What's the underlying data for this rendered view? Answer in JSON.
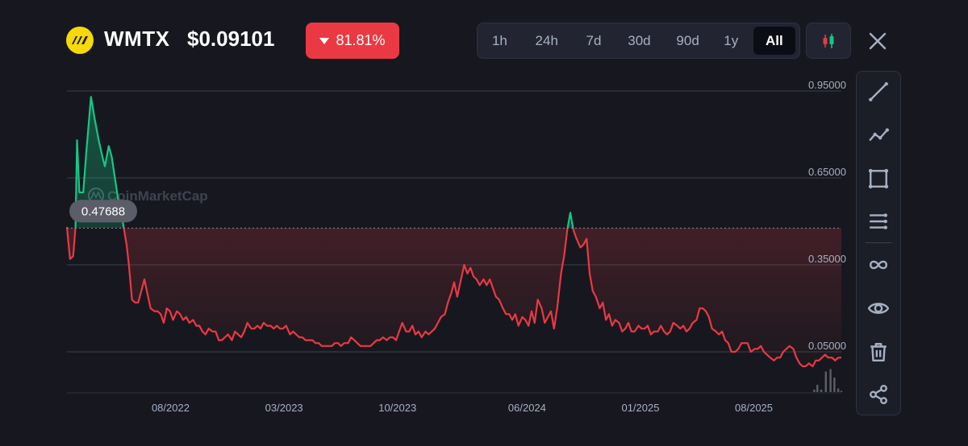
{
  "header": {
    "symbol": "WMTX",
    "price": "$0.09101",
    "change": "81.81%",
    "change_direction": "down",
    "logo_icon": "wmtx-logo-icon",
    "ranges": [
      {
        "label": "1h",
        "active": false
      },
      {
        "label": "24h",
        "active": false
      },
      {
        "label": "7d",
        "active": false
      },
      {
        "label": "30d",
        "active": false
      },
      {
        "label": "90d",
        "active": false
      },
      {
        "label": "1y",
        "active": false
      },
      {
        "label": "All",
        "active": true
      }
    ],
    "candle_icon": "candlestick-icon",
    "close_icon": "close-icon"
  },
  "toolbar": {
    "tools": [
      "trend-line-icon",
      "multi-point-line-icon",
      "rectangle-icon",
      "horizontal-lines-icon",
      "infinity-icon",
      "eye-icon",
      "trash-icon",
      "share-icon"
    ]
  },
  "colors": {
    "up": "#16c784",
    "down": "#ea3943",
    "background": "#17181f",
    "grid": "#3a3f4d"
  },
  "chart_data": {
    "type": "line",
    "watermark": "CoinMarketCap",
    "reference_label": "0.47688",
    "reference_value": 0.47688,
    "y_ticks": [
      {
        "label": "0.95000",
        "value": 0.95
      },
      {
        "label": "0.65000",
        "value": 0.65
      },
      {
        "label": "0.35000",
        "value": 0.35
      },
      {
        "label": "0.05000",
        "value": 0.05
      }
    ],
    "ylim": [
      -0.09,
      0.99
    ],
    "x_ticks": [
      {
        "label": "08/2022",
        "t": 0.1338
      },
      {
        "label": "03/2023",
        "t": 0.2804
      },
      {
        "label": "10/2023",
        "t": 0.4268
      },
      {
        "label": "06/2024",
        "t": 0.5942
      },
      {
        "label": "01/2025",
        "t": 0.7406
      },
      {
        "label": "08/2025",
        "t": 0.887
      }
    ],
    "xlim": [
      0,
      1
    ],
    "series": [
      {
        "points": [
          [
            0.0,
            0.48
          ],
          [
            0.004,
            0.37
          ],
          [
            0.008,
            0.38
          ],
          [
            0.011,
            0.48
          ],
          [
            0.013,
            0.78
          ],
          [
            0.016,
            0.6
          ],
          [
            0.021,
            0.6
          ],
          [
            0.025,
            0.74
          ],
          [
            0.031,
            0.93
          ],
          [
            0.036,
            0.85
          ],
          [
            0.041,
            0.78
          ],
          [
            0.046,
            0.72
          ],
          [
            0.049,
            0.69
          ],
          [
            0.054,
            0.76
          ],
          [
            0.058,
            0.72
          ],
          [
            0.063,
            0.63
          ],
          [
            0.067,
            0.56
          ],
          [
            0.072,
            0.5
          ],
          [
            0.077,
            0.42
          ],
          [
            0.08,
            0.35
          ],
          [
            0.084,
            0.23
          ],
          [
            0.088,
            0.22
          ],
          [
            0.092,
            0.22
          ],
          [
            0.096,
            0.26
          ],
          [
            0.1,
            0.3
          ],
          [
            0.104,
            0.25
          ],
          [
            0.108,
            0.2
          ],
          [
            0.113,
            0.19
          ],
          [
            0.117,
            0.19
          ],
          [
            0.121,
            0.18
          ],
          [
            0.125,
            0.15
          ],
          [
            0.129,
            0.2
          ],
          [
            0.133,
            0.19
          ],
          [
            0.137,
            0.16
          ],
          [
            0.142,
            0.19
          ],
          [
            0.146,
            0.18
          ],
          [
            0.15,
            0.16
          ],
          [
            0.154,
            0.17
          ],
          [
            0.158,
            0.15
          ],
          [
            0.163,
            0.16
          ],
          [
            0.167,
            0.14
          ],
          [
            0.171,
            0.14
          ],
          [
            0.175,
            0.12
          ],
          [
            0.179,
            0.11
          ],
          [
            0.183,
            0.13
          ],
          [
            0.188,
            0.12
          ],
          [
            0.192,
            0.12
          ],
          [
            0.196,
            0.09
          ],
          [
            0.2,
            0.09
          ],
          [
            0.204,
            0.1
          ],
          [
            0.208,
            0.11
          ],
          [
            0.213,
            0.09
          ],
          [
            0.217,
            0.12
          ],
          [
            0.221,
            0.11
          ],
          [
            0.225,
            0.1
          ],
          [
            0.229,
            0.12
          ],
          [
            0.233,
            0.15
          ],
          [
            0.238,
            0.13
          ],
          [
            0.242,
            0.13
          ],
          [
            0.246,
            0.14
          ],
          [
            0.25,
            0.13
          ],
          [
            0.254,
            0.15
          ],
          [
            0.258,
            0.14
          ],
          [
            0.263,
            0.14
          ],
          [
            0.267,
            0.13
          ],
          [
            0.271,
            0.14
          ],
          [
            0.275,
            0.13
          ],
          [
            0.279,
            0.13
          ],
          [
            0.283,
            0.14
          ],
          [
            0.288,
            0.11
          ],
          [
            0.292,
            0.12
          ],
          [
            0.296,
            0.11
          ],
          [
            0.3,
            0.1
          ],
          [
            0.304,
            0.1
          ],
          [
            0.308,
            0.09
          ],
          [
            0.313,
            0.09
          ],
          [
            0.317,
            0.09
          ],
          [
            0.321,
            0.08
          ],
          [
            0.325,
            0.08
          ],
          [
            0.329,
            0.07
          ],
          [
            0.333,
            0.07
          ],
          [
            0.338,
            0.07
          ],
          [
            0.342,
            0.07
          ],
          [
            0.346,
            0.08
          ],
          [
            0.35,
            0.08
          ],
          [
            0.354,
            0.07
          ],
          [
            0.358,
            0.08
          ],
          [
            0.363,
            0.08
          ],
          [
            0.367,
            0.1
          ],
          [
            0.371,
            0.09
          ],
          [
            0.375,
            0.08
          ],
          [
            0.379,
            0.07
          ],
          [
            0.383,
            0.07
          ],
          [
            0.388,
            0.07
          ],
          [
            0.392,
            0.07
          ],
          [
            0.396,
            0.08
          ],
          [
            0.4,
            0.09
          ],
          [
            0.404,
            0.09
          ],
          [
            0.408,
            0.1
          ],
          [
            0.413,
            0.09
          ],
          [
            0.417,
            0.1
          ],
          [
            0.421,
            0.1
          ],
          [
            0.425,
            0.09
          ],
          [
            0.429,
            0.12
          ],
          [
            0.433,
            0.15
          ],
          [
            0.438,
            0.12
          ],
          [
            0.442,
            0.12
          ],
          [
            0.446,
            0.14
          ],
          [
            0.45,
            0.11
          ],
          [
            0.454,
            0.12
          ],
          [
            0.458,
            0.1
          ],
          [
            0.463,
            0.12
          ],
          [
            0.467,
            0.11
          ],
          [
            0.471,
            0.12
          ],
          [
            0.475,
            0.13
          ],
          [
            0.479,
            0.15
          ],
          [
            0.483,
            0.17
          ],
          [
            0.488,
            0.18
          ],
          [
            0.492,
            0.22
          ],
          [
            0.496,
            0.25
          ],
          [
            0.5,
            0.29
          ],
          [
            0.504,
            0.24
          ],
          [
            0.508,
            0.29
          ],
          [
            0.513,
            0.35
          ],
          [
            0.517,
            0.32
          ],
          [
            0.521,
            0.34
          ],
          [
            0.525,
            0.31
          ],
          [
            0.529,
            0.3
          ],
          [
            0.533,
            0.28
          ],
          [
            0.538,
            0.3
          ],
          [
            0.542,
            0.28
          ],
          [
            0.546,
            0.3
          ],
          [
            0.55,
            0.27
          ],
          [
            0.554,
            0.24
          ],
          [
            0.558,
            0.23
          ],
          [
            0.563,
            0.2
          ],
          [
            0.567,
            0.18
          ],
          [
            0.571,
            0.18
          ],
          [
            0.575,
            0.16
          ],
          [
            0.579,
            0.18
          ],
          [
            0.583,
            0.14
          ],
          [
            0.588,
            0.17
          ],
          [
            0.592,
            0.16
          ],
          [
            0.596,
            0.14
          ],
          [
            0.6,
            0.19
          ],
          [
            0.604,
            0.15
          ],
          [
            0.608,
            0.23
          ],
          [
            0.613,
            0.2
          ],
          [
            0.617,
            0.15
          ],
          [
            0.621,
            0.17
          ],
          [
            0.625,
            0.19
          ],
          [
            0.629,
            0.13
          ],
          [
            0.633,
            0.2
          ],
          [
            0.638,
            0.32
          ],
          [
            0.642,
            0.38
          ],
          [
            0.646,
            0.47
          ],
          [
            0.65,
            0.53
          ],
          [
            0.654,
            0.47
          ],
          [
            0.658,
            0.44
          ],
          [
            0.663,
            0.41
          ],
          [
            0.667,
            0.42
          ],
          [
            0.671,
            0.44
          ],
          [
            0.675,
            0.32
          ],
          [
            0.679,
            0.26
          ],
          [
            0.683,
            0.24
          ],
          [
            0.688,
            0.2
          ],
          [
            0.692,
            0.22
          ],
          [
            0.696,
            0.16
          ],
          [
            0.7,
            0.18
          ],
          [
            0.704,
            0.14
          ],
          [
            0.708,
            0.16
          ],
          [
            0.713,
            0.15
          ],
          [
            0.717,
            0.12
          ],
          [
            0.721,
            0.13
          ],
          [
            0.725,
            0.15
          ],
          [
            0.729,
            0.12
          ],
          [
            0.733,
            0.12
          ],
          [
            0.738,
            0.14
          ],
          [
            0.742,
            0.13
          ],
          [
            0.746,
            0.13
          ],
          [
            0.75,
            0.14
          ],
          [
            0.754,
            0.11
          ],
          [
            0.758,
            0.12
          ],
          [
            0.763,
            0.12
          ],
          [
            0.767,
            0.14
          ],
          [
            0.771,
            0.12
          ],
          [
            0.775,
            0.11
          ],
          [
            0.779,
            0.12
          ],
          [
            0.783,
            0.15
          ],
          [
            0.788,
            0.14
          ],
          [
            0.792,
            0.13
          ],
          [
            0.796,
            0.14
          ],
          [
            0.8,
            0.12
          ],
          [
            0.804,
            0.13
          ],
          [
            0.808,
            0.15
          ],
          [
            0.813,
            0.16
          ],
          [
            0.817,
            0.2
          ],
          [
            0.821,
            0.2
          ],
          [
            0.825,
            0.19
          ],
          [
            0.829,
            0.17
          ],
          [
            0.833,
            0.13
          ],
          [
            0.838,
            0.12
          ],
          [
            0.842,
            0.11
          ],
          [
            0.846,
            0.12
          ],
          [
            0.85,
            0.09
          ],
          [
            0.854,
            0.08
          ],
          [
            0.858,
            0.05
          ],
          [
            0.863,
            0.05
          ],
          [
            0.867,
            0.06
          ],
          [
            0.871,
            0.08
          ],
          [
            0.875,
            0.08
          ],
          [
            0.879,
            0.08
          ],
          [
            0.883,
            0.05
          ],
          [
            0.888,
            0.06
          ],
          [
            0.892,
            0.06
          ],
          [
            0.896,
            0.07
          ],
          [
            0.9,
            0.05
          ],
          [
            0.904,
            0.04
          ],
          [
            0.908,
            0.03
          ],
          [
            0.913,
            0.02
          ],
          [
            0.917,
            0.03
          ],
          [
            0.921,
            0.03
          ],
          [
            0.925,
            0.05
          ],
          [
            0.929,
            0.06
          ],
          [
            0.933,
            0.07
          ],
          [
            0.938,
            0.06
          ],
          [
            0.942,
            0.03
          ],
          [
            0.946,
            0.01
          ],
          [
            0.95,
            0.0
          ],
          [
            0.954,
            0.0
          ],
          [
            0.958,
            0.01
          ],
          [
            0.963,
            0.0
          ],
          [
            0.967,
            0.02
          ],
          [
            0.971,
            0.02
          ],
          [
            0.975,
            0.03
          ],
          [
            0.979,
            0.04
          ],
          [
            0.983,
            0.03
          ],
          [
            0.988,
            0.03
          ],
          [
            0.992,
            0.02
          ],
          [
            0.996,
            0.03
          ],
          [
            1.0,
            0.03
          ]
        ]
      }
    ],
    "volume": [
      [
        0.965,
        0.1
      ],
      [
        0.969,
        0.3
      ],
      [
        0.974,
        0.1
      ],
      [
        0.98,
        0.85
      ],
      [
        0.986,
        0.95
      ],
      [
        0.991,
        0.6
      ],
      [
        0.996,
        0.15
      ],
      [
        1.0,
        0.05
      ]
    ],
    "grid": true
  }
}
